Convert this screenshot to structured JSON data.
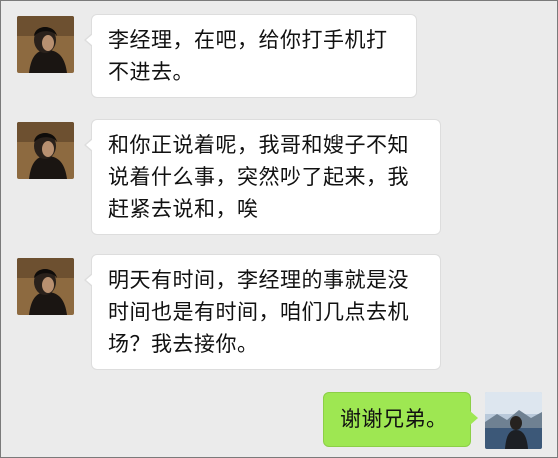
{
  "messages": [
    {
      "direction": "incoming",
      "avatar_icon": "contact-avatar-icon",
      "text": "李经理，在吧，给你打手机打不进去。"
    },
    {
      "direction": "incoming",
      "avatar_icon": "contact-avatar-icon",
      "text": "和你正说着呢，我哥和嫂子不知说着什么事，突然吵了起来，我赶紧去说和，唉"
    },
    {
      "direction": "incoming",
      "avatar_icon": "contact-avatar-icon",
      "text": "明天有时间，李经理的事就是没时间也是有时间，咱们几点去机场？我去接你。"
    },
    {
      "direction": "outgoing",
      "avatar_icon": "self-avatar-icon",
      "text": "谢谢兄弟。"
    }
  ],
  "colors": {
    "background": "#ebebeb",
    "incoming_bubble": "#ffffff",
    "outgoing_bubble": "#9ee752"
  }
}
